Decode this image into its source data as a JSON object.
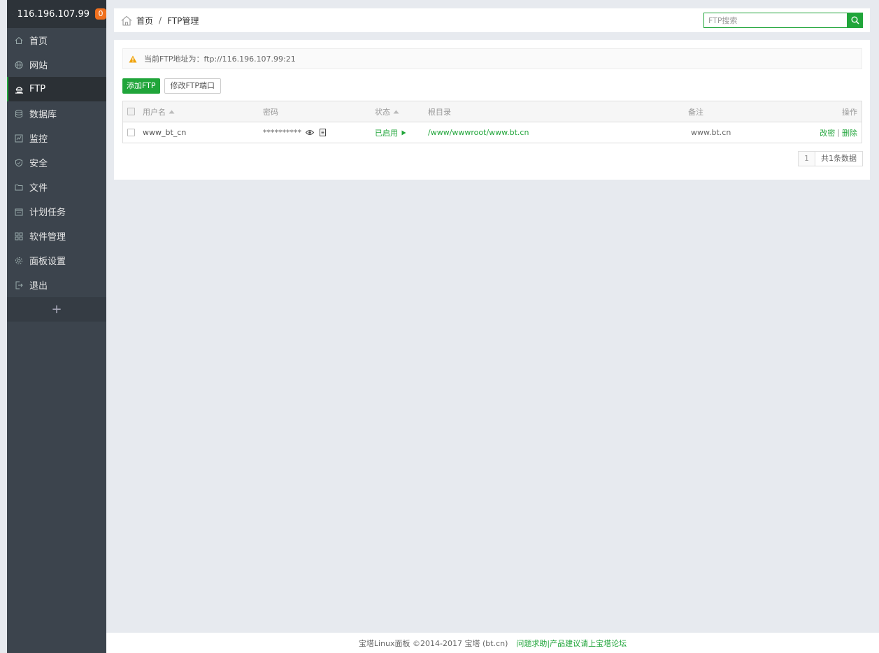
{
  "sidebar": {
    "server_ip": "116.196.107.99",
    "badge": "0",
    "items": [
      {
        "label": "首页",
        "icon": "home-icon",
        "active": false
      },
      {
        "label": "网站",
        "icon": "globe-icon",
        "active": false
      },
      {
        "label": "FTP",
        "icon": "ftp-icon",
        "active": true
      },
      {
        "label": "数据库",
        "icon": "database-icon",
        "active": false
      },
      {
        "label": "监控",
        "icon": "monitor-icon",
        "active": false
      },
      {
        "label": "安全",
        "icon": "shield-icon",
        "active": false
      },
      {
        "label": "文件",
        "icon": "folder-icon",
        "active": false
      },
      {
        "label": "计划任务",
        "icon": "calendar-icon",
        "active": false
      },
      {
        "label": "软件管理",
        "icon": "grid-icon",
        "active": false
      },
      {
        "label": "面板设置",
        "icon": "gear-icon",
        "active": false
      },
      {
        "label": "退出",
        "icon": "logout-icon",
        "active": false
      }
    ],
    "plus": "+"
  },
  "header": {
    "breadcrumb_home": "首页",
    "breadcrumb_sep": "/",
    "breadcrumb_current": "FTP管理",
    "search_placeholder": "FTP搜索"
  },
  "notice": {
    "text": "当前FTP地址为：ftp://116.196.107.99:21"
  },
  "toolbar": {
    "add_label": "添加FTP",
    "port_label": "修改FTP端口"
  },
  "table": {
    "headers": {
      "username": "用户名",
      "password": "密码",
      "status": "状态",
      "root": "根目录",
      "remark": "备注",
      "action": "操作"
    },
    "rows": [
      {
        "username": "www_bt_cn",
        "password": "**********",
        "status": "已启用",
        "root": "/www/wwwroot/www.bt.cn",
        "remark": "www.bt.cn",
        "action_edit": "改密",
        "action_sep": "|",
        "action_delete": "删除"
      }
    ]
  },
  "pager": {
    "page": "1",
    "total": "共1条数据"
  },
  "footer": {
    "copyright": "宝塔Linux面板 ©2014-2017 宝塔 (bt.cn)",
    "link": "问题求助|产品建议请上宝塔论坛"
  },
  "colors": {
    "accent": "#20a53a",
    "sidebar_bg": "#3c444d",
    "badge": "#f0701e"
  }
}
